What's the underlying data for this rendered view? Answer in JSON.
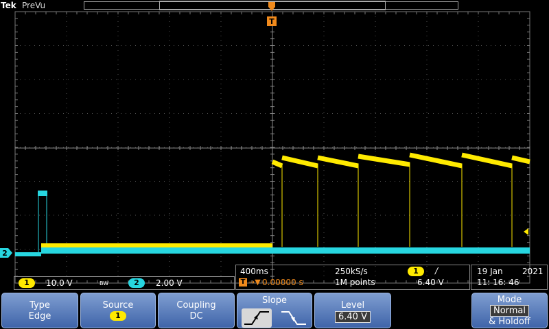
{
  "header": {
    "brand": "Tek",
    "mode": "PreVu"
  },
  "markers": {
    "trigger": "T",
    "ch2_ref": "2"
  },
  "channels": [
    {
      "id": "1",
      "scale": "10.0 V",
      "bw": "BW",
      "color": "#ffea00"
    },
    {
      "id": "2",
      "scale": "2.00 V",
      "color": "#27d6e0"
    }
  ],
  "timebase": {
    "scale": "400ms",
    "sample_rate": "250kS/s",
    "position": "0.00000 s",
    "record_length": "1M points"
  },
  "trigger": {
    "source": "1",
    "slope_symbol": "/",
    "level": "6.40 V"
  },
  "datetime": {
    "date": "19 Jan",
    "year": "2021",
    "time": "11: 16: 46"
  },
  "menu": {
    "type": {
      "label": "Type",
      "value": "Edge"
    },
    "source": {
      "label": "Source",
      "value": "1"
    },
    "coupling": {
      "label": "Coupling",
      "value": "DC"
    },
    "slope": {
      "label": "Slope"
    },
    "level": {
      "label": "Level",
      "value": "6.40 V"
    },
    "mode": {
      "label": "Mode",
      "value": "Normal",
      "suffix": "& Holdoff"
    }
  }
}
